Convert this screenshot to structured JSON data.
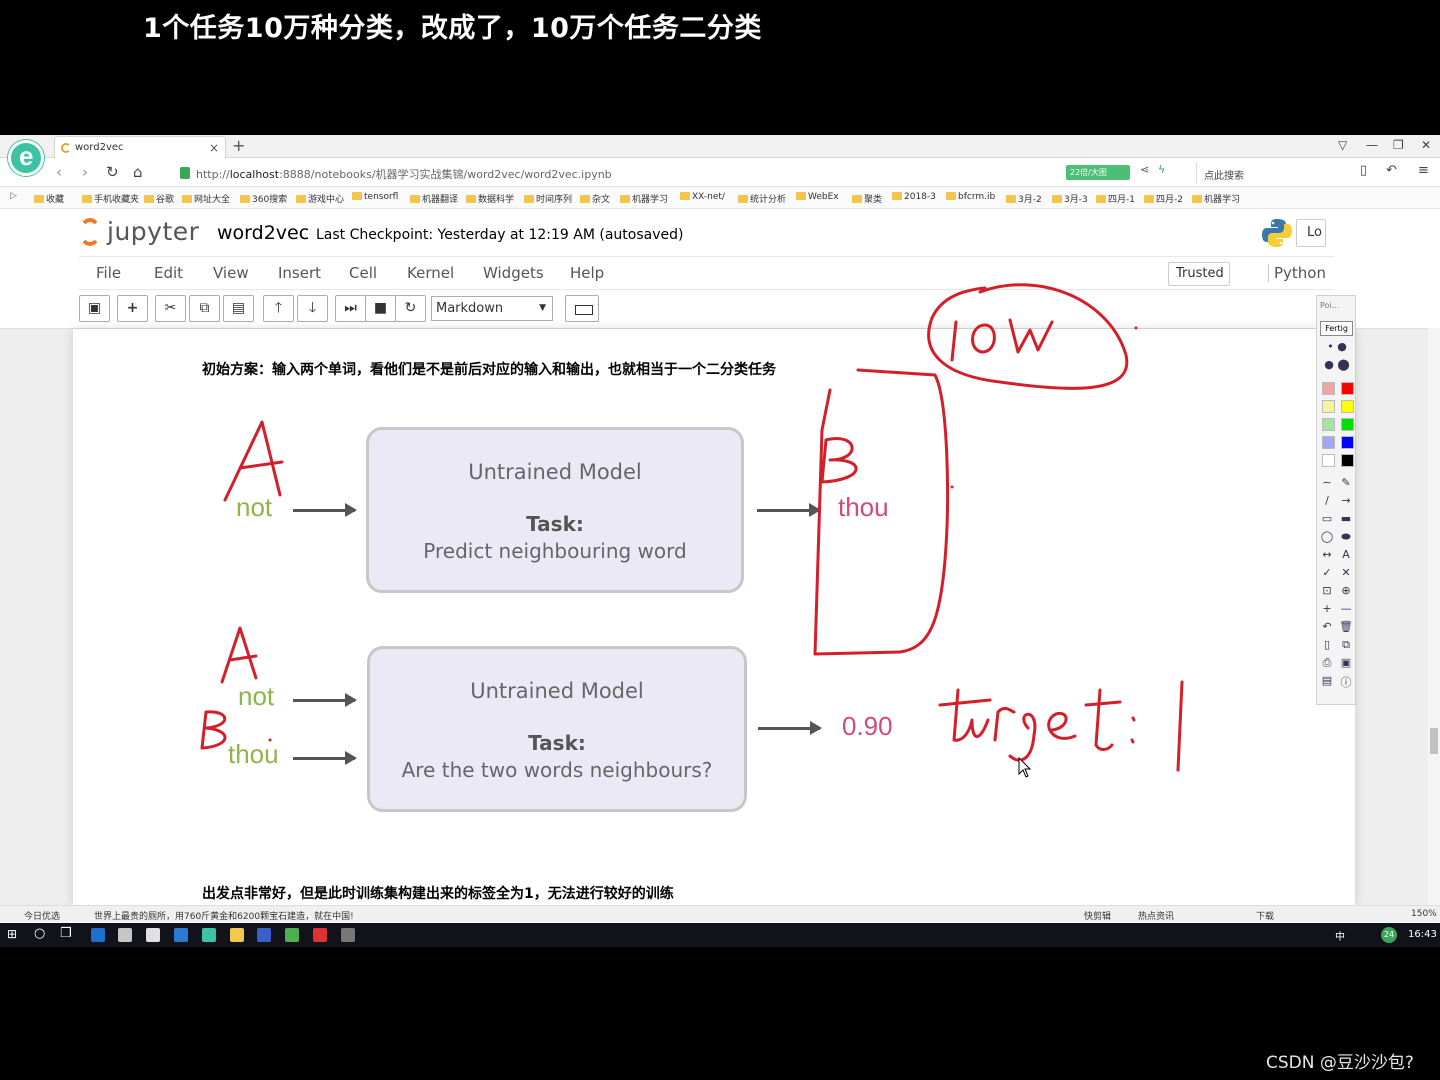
{
  "caption": "1个任务10万种分类，改成了，10万个任务二分类",
  "browser": {
    "tab_title": "word2vec",
    "url_prefix": "http://",
    "url_host": "localhost",
    "url_rest": ":8888/notebooks/机器学习实战集锦/word2vec/word2vec.ipynb",
    "speed_badge": "22倍/大图",
    "search_placeholder": "点此搜索",
    "bookmarks": [
      "收藏",
      "手机收藏夹",
      "谷歌",
      "网址大全",
      "360搜索",
      "游戏中心",
      "tensorfl",
      "机器翻译",
      "数据科学",
      "时间序列",
      "杂文",
      "机器学习",
      "XX-net/",
      "统计分析",
      "WebEx",
      "聚类",
      "2018-3",
      "bfcrm.ib",
      "3月-2",
      "3月-3",
      "四月-1",
      "四月-2",
      "机器学习"
    ]
  },
  "jupyter": {
    "logo_text": "jupyter",
    "notebook_name": "word2vec",
    "checkpoint": "Last Checkpoint: Yesterday at 12:19 AM (autosaved)",
    "logout_label": "Lo",
    "menu": [
      "File",
      "Edit",
      "View",
      "Insert",
      "Cell",
      "Kernel",
      "Widgets",
      "Help"
    ],
    "trusted": "Trusted",
    "kernel": "Python",
    "cell_type": "Markdown"
  },
  "content": {
    "intro": "初始方案：输入两个单词，看他们是不是前后对应的输入和输出，也就相当于一个二分类任务",
    "box1": {
      "title": "Untrained Model",
      "task_label": "Task:",
      "task_text": "Predict neighbouring word"
    },
    "box2": {
      "title": "Untrained Model",
      "task_label": "Task:",
      "task_text": "Are the two words neighbours?"
    },
    "input1": "not",
    "output1": "thou",
    "input2a": "not",
    "input2b": "thou",
    "output2": "0.90",
    "conclusion": "出发点非常好，但是此时训练集构建出来的标签全为1，无法进行较好的训练"
  },
  "annotations": {
    "letter_a": "A",
    "letter_b": "B",
    "label_10w": "10W",
    "label_target": "target : 1",
    "ink_color": "#d41f2a"
  },
  "palette": {
    "fertig": "Fertig",
    "title": "Poi..."
  },
  "statusbar": {
    "left": "今日优选",
    "news": "世界上最贵的厕所，用760斤黄金和6200颗宝石建造，就在中国!",
    "right_items": [
      "快剪辑",
      "热点资讯",
      "下载"
    ],
    "zoom": "150%"
  },
  "taskbar": {
    "time": "16:43",
    "ime": "中",
    "badge": "24"
  },
  "watermark": "CSDN @豆沙沙包?"
}
